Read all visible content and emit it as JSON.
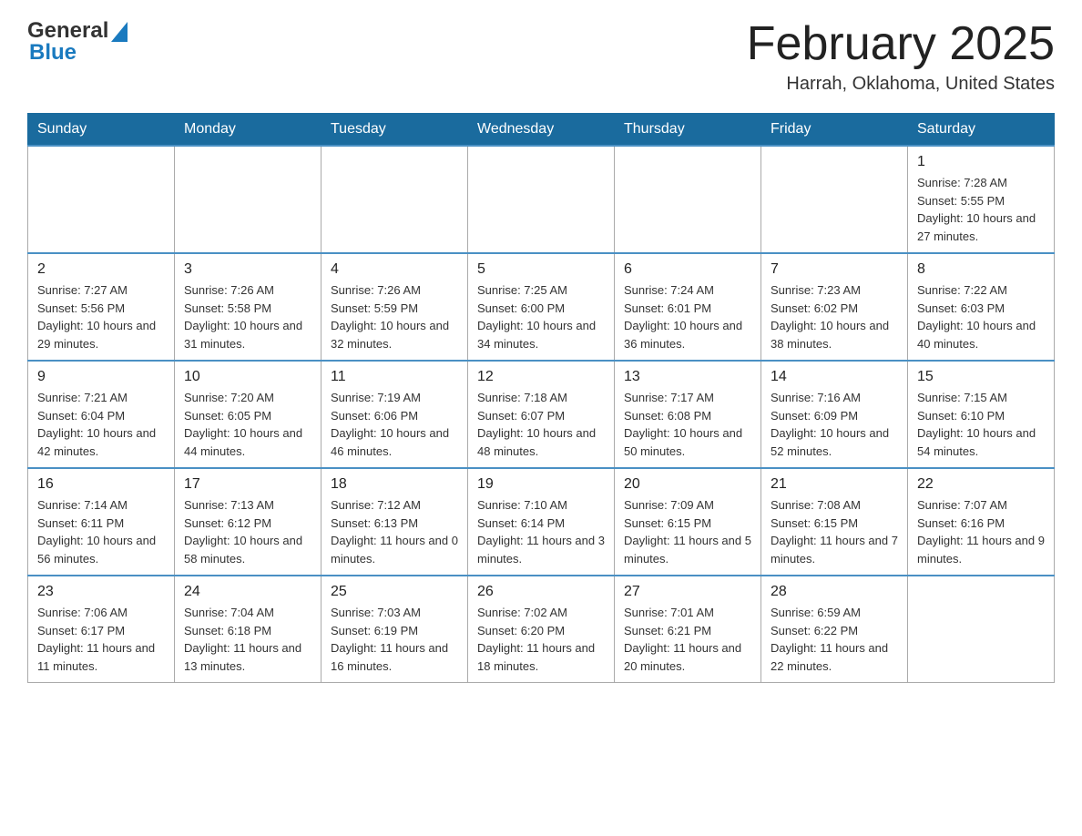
{
  "logo": {
    "text_general": "General",
    "text_blue": "Blue"
  },
  "header": {
    "title": "February 2025",
    "location": "Harrah, Oklahoma, United States"
  },
  "weekdays": [
    "Sunday",
    "Monday",
    "Tuesday",
    "Wednesday",
    "Thursday",
    "Friday",
    "Saturday"
  ],
  "weeks": [
    [
      {
        "day": "",
        "sunrise": "",
        "sunset": "",
        "daylight": ""
      },
      {
        "day": "",
        "sunrise": "",
        "sunset": "",
        "daylight": ""
      },
      {
        "day": "",
        "sunrise": "",
        "sunset": "",
        "daylight": ""
      },
      {
        "day": "",
        "sunrise": "",
        "sunset": "",
        "daylight": ""
      },
      {
        "day": "",
        "sunrise": "",
        "sunset": "",
        "daylight": ""
      },
      {
        "day": "",
        "sunrise": "",
        "sunset": "",
        "daylight": ""
      },
      {
        "day": "1",
        "sunrise": "Sunrise: 7:28 AM",
        "sunset": "Sunset: 5:55 PM",
        "daylight": "Daylight: 10 hours and 27 minutes."
      }
    ],
    [
      {
        "day": "2",
        "sunrise": "Sunrise: 7:27 AM",
        "sunset": "Sunset: 5:56 PM",
        "daylight": "Daylight: 10 hours and 29 minutes."
      },
      {
        "day": "3",
        "sunrise": "Sunrise: 7:26 AM",
        "sunset": "Sunset: 5:58 PM",
        "daylight": "Daylight: 10 hours and 31 minutes."
      },
      {
        "day": "4",
        "sunrise": "Sunrise: 7:26 AM",
        "sunset": "Sunset: 5:59 PM",
        "daylight": "Daylight: 10 hours and 32 minutes."
      },
      {
        "day": "5",
        "sunrise": "Sunrise: 7:25 AM",
        "sunset": "Sunset: 6:00 PM",
        "daylight": "Daylight: 10 hours and 34 minutes."
      },
      {
        "day": "6",
        "sunrise": "Sunrise: 7:24 AM",
        "sunset": "Sunset: 6:01 PM",
        "daylight": "Daylight: 10 hours and 36 minutes."
      },
      {
        "day": "7",
        "sunrise": "Sunrise: 7:23 AM",
        "sunset": "Sunset: 6:02 PM",
        "daylight": "Daylight: 10 hours and 38 minutes."
      },
      {
        "day": "8",
        "sunrise": "Sunrise: 7:22 AM",
        "sunset": "Sunset: 6:03 PM",
        "daylight": "Daylight: 10 hours and 40 minutes."
      }
    ],
    [
      {
        "day": "9",
        "sunrise": "Sunrise: 7:21 AM",
        "sunset": "Sunset: 6:04 PM",
        "daylight": "Daylight: 10 hours and 42 minutes."
      },
      {
        "day": "10",
        "sunrise": "Sunrise: 7:20 AM",
        "sunset": "Sunset: 6:05 PM",
        "daylight": "Daylight: 10 hours and 44 minutes."
      },
      {
        "day": "11",
        "sunrise": "Sunrise: 7:19 AM",
        "sunset": "Sunset: 6:06 PM",
        "daylight": "Daylight: 10 hours and 46 minutes."
      },
      {
        "day": "12",
        "sunrise": "Sunrise: 7:18 AM",
        "sunset": "Sunset: 6:07 PM",
        "daylight": "Daylight: 10 hours and 48 minutes."
      },
      {
        "day": "13",
        "sunrise": "Sunrise: 7:17 AM",
        "sunset": "Sunset: 6:08 PM",
        "daylight": "Daylight: 10 hours and 50 minutes."
      },
      {
        "day": "14",
        "sunrise": "Sunrise: 7:16 AM",
        "sunset": "Sunset: 6:09 PM",
        "daylight": "Daylight: 10 hours and 52 minutes."
      },
      {
        "day": "15",
        "sunrise": "Sunrise: 7:15 AM",
        "sunset": "Sunset: 6:10 PM",
        "daylight": "Daylight: 10 hours and 54 minutes."
      }
    ],
    [
      {
        "day": "16",
        "sunrise": "Sunrise: 7:14 AM",
        "sunset": "Sunset: 6:11 PM",
        "daylight": "Daylight: 10 hours and 56 minutes."
      },
      {
        "day": "17",
        "sunrise": "Sunrise: 7:13 AM",
        "sunset": "Sunset: 6:12 PM",
        "daylight": "Daylight: 10 hours and 58 minutes."
      },
      {
        "day": "18",
        "sunrise": "Sunrise: 7:12 AM",
        "sunset": "Sunset: 6:13 PM",
        "daylight": "Daylight: 11 hours and 0 minutes."
      },
      {
        "day": "19",
        "sunrise": "Sunrise: 7:10 AM",
        "sunset": "Sunset: 6:14 PM",
        "daylight": "Daylight: 11 hours and 3 minutes."
      },
      {
        "day": "20",
        "sunrise": "Sunrise: 7:09 AM",
        "sunset": "Sunset: 6:15 PM",
        "daylight": "Daylight: 11 hours and 5 minutes."
      },
      {
        "day": "21",
        "sunrise": "Sunrise: 7:08 AM",
        "sunset": "Sunset: 6:15 PM",
        "daylight": "Daylight: 11 hours and 7 minutes."
      },
      {
        "day": "22",
        "sunrise": "Sunrise: 7:07 AM",
        "sunset": "Sunset: 6:16 PM",
        "daylight": "Daylight: 11 hours and 9 minutes."
      }
    ],
    [
      {
        "day": "23",
        "sunrise": "Sunrise: 7:06 AM",
        "sunset": "Sunset: 6:17 PM",
        "daylight": "Daylight: 11 hours and 11 minutes."
      },
      {
        "day": "24",
        "sunrise": "Sunrise: 7:04 AM",
        "sunset": "Sunset: 6:18 PM",
        "daylight": "Daylight: 11 hours and 13 minutes."
      },
      {
        "day": "25",
        "sunrise": "Sunrise: 7:03 AM",
        "sunset": "Sunset: 6:19 PM",
        "daylight": "Daylight: 11 hours and 16 minutes."
      },
      {
        "day": "26",
        "sunrise": "Sunrise: 7:02 AM",
        "sunset": "Sunset: 6:20 PM",
        "daylight": "Daylight: 11 hours and 18 minutes."
      },
      {
        "day": "27",
        "sunrise": "Sunrise: 7:01 AM",
        "sunset": "Sunset: 6:21 PM",
        "daylight": "Daylight: 11 hours and 20 minutes."
      },
      {
        "day": "28",
        "sunrise": "Sunrise: 6:59 AM",
        "sunset": "Sunset: 6:22 PM",
        "daylight": "Daylight: 11 hours and 22 minutes."
      },
      {
        "day": "",
        "sunrise": "",
        "sunset": "",
        "daylight": ""
      }
    ]
  ]
}
